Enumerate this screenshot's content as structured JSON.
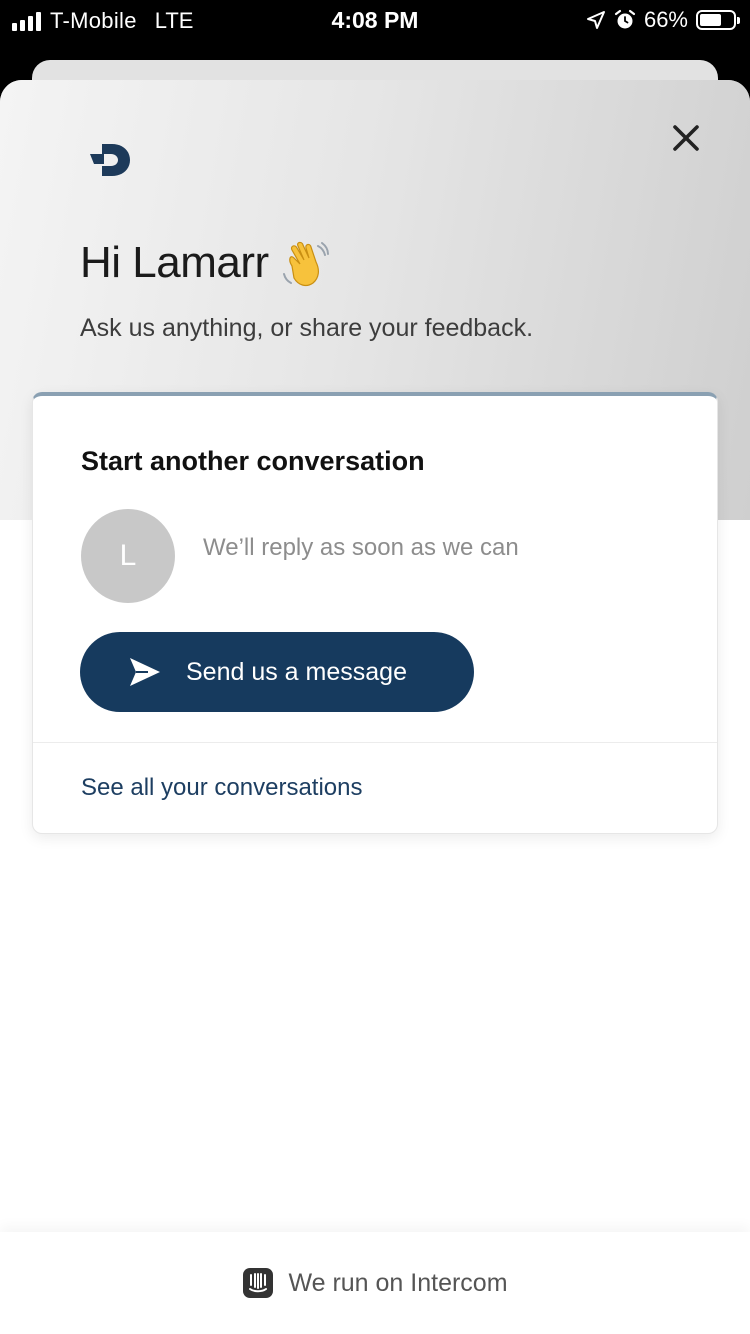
{
  "status_bar": {
    "carrier": "T-Mobile",
    "network": "LTE",
    "time": "4:08 PM",
    "battery_percent": "66%",
    "battery_level": 0.66,
    "icons": [
      "signal-icon",
      "location-arrow-icon",
      "alarm-icon",
      "battery-icon"
    ]
  },
  "header": {
    "logo": "d-logo-icon",
    "close_icon": "close-icon",
    "greeting": "Hi Lamarr",
    "greeting_emoji_icon": "waving-hand-icon",
    "subtitle": "Ask us anything, or share your feedback."
  },
  "card": {
    "title": "Start another conversation",
    "avatar_letter": "L",
    "reply_text": "We’ll reply as soon as we can",
    "send_button_label": "Send us a message",
    "send_icon": "send-icon",
    "see_all_link": "See all your conversations"
  },
  "footer": {
    "icon": "intercom-icon",
    "text": "We run on Intercom"
  },
  "colors": {
    "primary": "#163a5e",
    "link": "#1d3e61",
    "avatar_bg": "#c8c8c8",
    "card_top_border": "#8aa0b2"
  }
}
